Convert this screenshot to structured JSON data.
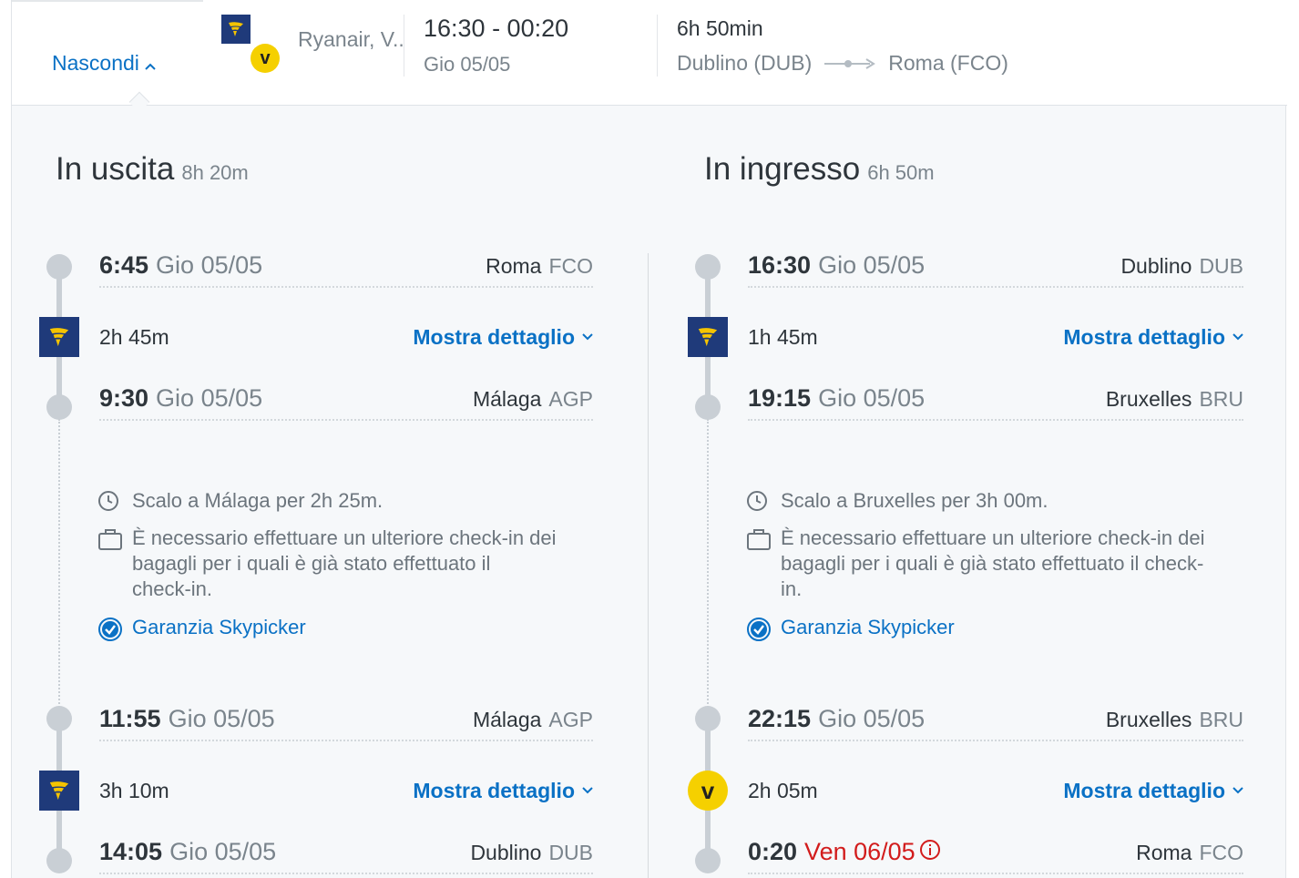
{
  "header": {
    "hide_label": "Nascondi",
    "airlines_text": "Ryanair, V..",
    "time_range": "16:30 - 00:20",
    "date": "Gio 05/05",
    "duration": "6h 50min",
    "from": "Dublino (DUB)",
    "to": "Roma (FCO)"
  },
  "outbound": {
    "title": "In uscita",
    "duration": "8h 20m",
    "stops": [
      {
        "time": "6:45",
        "date": "Gio 05/05",
        "city": "Roma",
        "code": "FCO"
      },
      {
        "time": "9:30",
        "date": "Gio 05/05",
        "city": "Málaga",
        "code": "AGP"
      },
      {
        "time": "11:55",
        "date": "Gio 05/05",
        "city": "Málaga",
        "code": "AGP"
      },
      {
        "time": "14:05",
        "date": "Gio 05/05",
        "city": "Dublino",
        "code": "DUB"
      }
    ],
    "segments": [
      {
        "duration": "2h 45m",
        "details_label": "Mostra dettaglio",
        "airline_icon": "ryanair-icon"
      },
      {
        "duration": "3h 10m",
        "details_label": "Mostra dettaglio",
        "airline_icon": "ryanair-icon"
      }
    ],
    "layover": {
      "text": "Scalo a Málaga per 2h 25m.",
      "bag_line1": "È necessario effettuare un ulteriore check-in dei",
      "bag_line2": "bagagli per i quali è già stato effettuato il",
      "bag_line3": "check-in.",
      "guarantee": "Garanzia Skypicker"
    }
  },
  "inbound": {
    "title": "In ingresso",
    "duration": "6h 50m",
    "stops": [
      {
        "time": "16:30",
        "date": "Gio 05/05",
        "city": "Dublino",
        "code": "DUB"
      },
      {
        "time": "19:15",
        "date": "Gio 05/05",
        "city": "Bruxelles",
        "code": "BRU"
      },
      {
        "time": "22:15",
        "date": "Gio 05/05",
        "city": "Bruxelles",
        "code": "BRU"
      },
      {
        "time": "0:20",
        "date": "Ven 06/05",
        "city": "Roma",
        "code": "FCO"
      }
    ],
    "segments": [
      {
        "duration": "1h 45m",
        "details_label": "Mostra dettaglio",
        "airline_icon": "ryanair-icon"
      },
      {
        "duration": "2h 05m",
        "details_label": "Mostra dettaglio",
        "airline_icon": "vueling-icon"
      }
    ],
    "layover": {
      "text": "Scalo a Bruxelles per 3h 00m.",
      "bag_line1": "È necessario effettuare un ulteriore check-in dei",
      "bag_line2": "bagagli per i quali è già stato effettuato il check-",
      "bag_line3": "in.",
      "guarantee": "Garanzia Skypicker"
    }
  },
  "colors": {
    "accent": "#0a71c5",
    "warning": "#d21c1c",
    "ryanair": "#1f3a7a",
    "vueling": "#f5d000"
  }
}
